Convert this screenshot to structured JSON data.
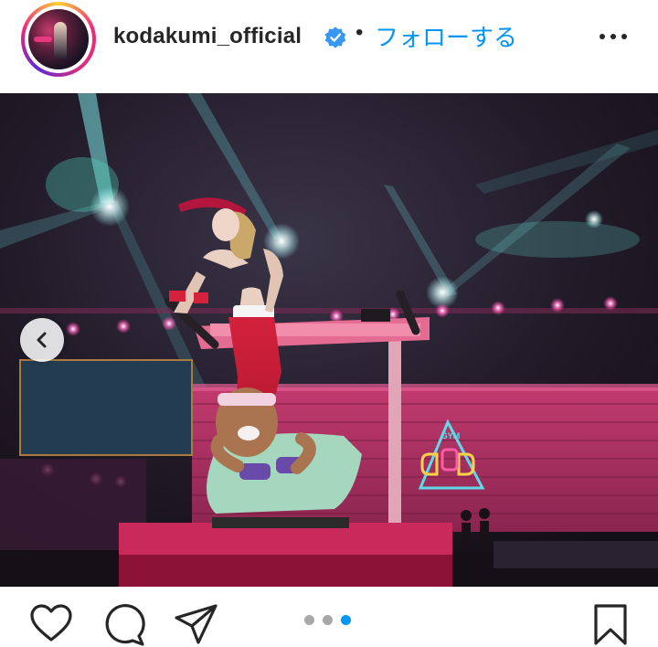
{
  "post": {
    "username": "kodakumi_official",
    "separator": "•",
    "follow_label": "フォローする",
    "verified": true
  },
  "photo": {
    "neon_sign": "GYM",
    "carousel": {
      "count": 3,
      "active_index": 2
    }
  },
  "icons": {
    "verified": "verified-badge-icon",
    "more": "more-options-icon",
    "prev": "chevron-left-icon",
    "like": "heart-icon",
    "comment": "comment-bubble-icon",
    "share": "paper-plane-icon",
    "save": "bookmark-icon"
  },
  "colors": {
    "link_blue": "#0095f6",
    "text_dark": "#262626",
    "dot_inactive": "#a8a8a8"
  }
}
